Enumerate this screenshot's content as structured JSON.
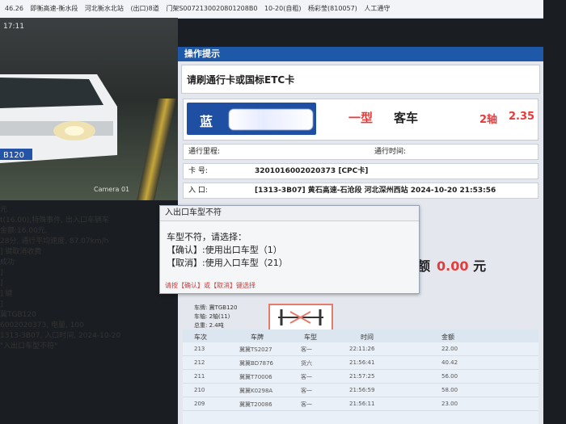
{
  "statusbar": {
    "items": [
      "46.26",
      "即衡高速-衡水段",
      "河北衡水北站",
      "(出口)8道",
      "门架S0072130020801208B0",
      "10-20(自粗)",
      "杨彩莹(810057)",
      "人工通守"
    ]
  },
  "camera": {
    "time": "17:11",
    "label": "Camera 01",
    "plate": "B120"
  },
  "left_log": {
    "lines": [
      "元",
      "t(16.00),特殊事件, 出入口车辆车",
      "金额:16.00元,",
      "28分, 通行平均速度, 87.07km/h",
      "",
      "] 键取消收费",
      "",
      "成功",
      "",
      "]",
      "]",
      "] 键",
      "]",
      "",
      "冀TGB120",
      "",
      "6002020373, 电量, 100",
      "1313-3B07, 入口时间, 2024-10-20",
      "",
      "\"入出口车型不符\"",
      "选择:",
      "出口车型(1)",
      "入口车型(21)"
    ]
  },
  "panel": {
    "header": "操作提示",
    "prompt": "请刷通行卡或国标ETC卡",
    "vehicle": {
      "plate_color": "蓝",
      "class": "一型",
      "type": "客车",
      "axles": "2轴",
      "weight": "2.35"
    },
    "rows": {
      "mileage_label": "通行里程:",
      "time_label": "通行时间:",
      "card_label": "卡  号:",
      "card_value": "3201016002020373 [CPC卡]",
      "entry_label": "入  口:",
      "entry_value": "[1313-3B07] 黄石高速-石沧段 河北深州西站 2024-10-20 21:53:56"
    },
    "amount_label": "金额",
    "amount_value": "0.00",
    "amount_unit": "元",
    "axle_info": {
      "plate": "车牌: 冀TGB120",
      "axle": "车轴: 2轴(11)",
      "weight": "总重: 2.4吨"
    },
    "table": {
      "headers": [
        "车次",
        "车牌",
        "车型",
        "时间",
        "金额"
      ],
      "rows": [
        [
          "213",
          "冀冀TS2027",
          "客一",
          "22:11:26",
          "22.00"
        ],
        [
          "212",
          "冀冀BD7876",
          "货六",
          "21:56:41",
          "40.42"
        ],
        [
          "211",
          "冀冀T70006",
          "客一",
          "21:57:25",
          "56.00"
        ],
        [
          "210",
          "冀冀K0298A",
          "客一",
          "21:56:59",
          "58.00"
        ],
        [
          "209",
          "冀冀T20086",
          "客一",
          "21:56:11",
          "23.00"
        ]
      ]
    }
  },
  "dialog": {
    "title": "入出口车型不符",
    "line1": "车型不符，请选择：",
    "line2": "【确认】:使用出口车型（1）",
    "line3": "【取消】:使用入口车型（21）",
    "hint": "请按【确认】或【取消】键选择"
  },
  "colors": {
    "header_blue": "#1e58a8",
    "plate_blue": "#1f4fa3",
    "accent_red": "#e53b3b"
  }
}
